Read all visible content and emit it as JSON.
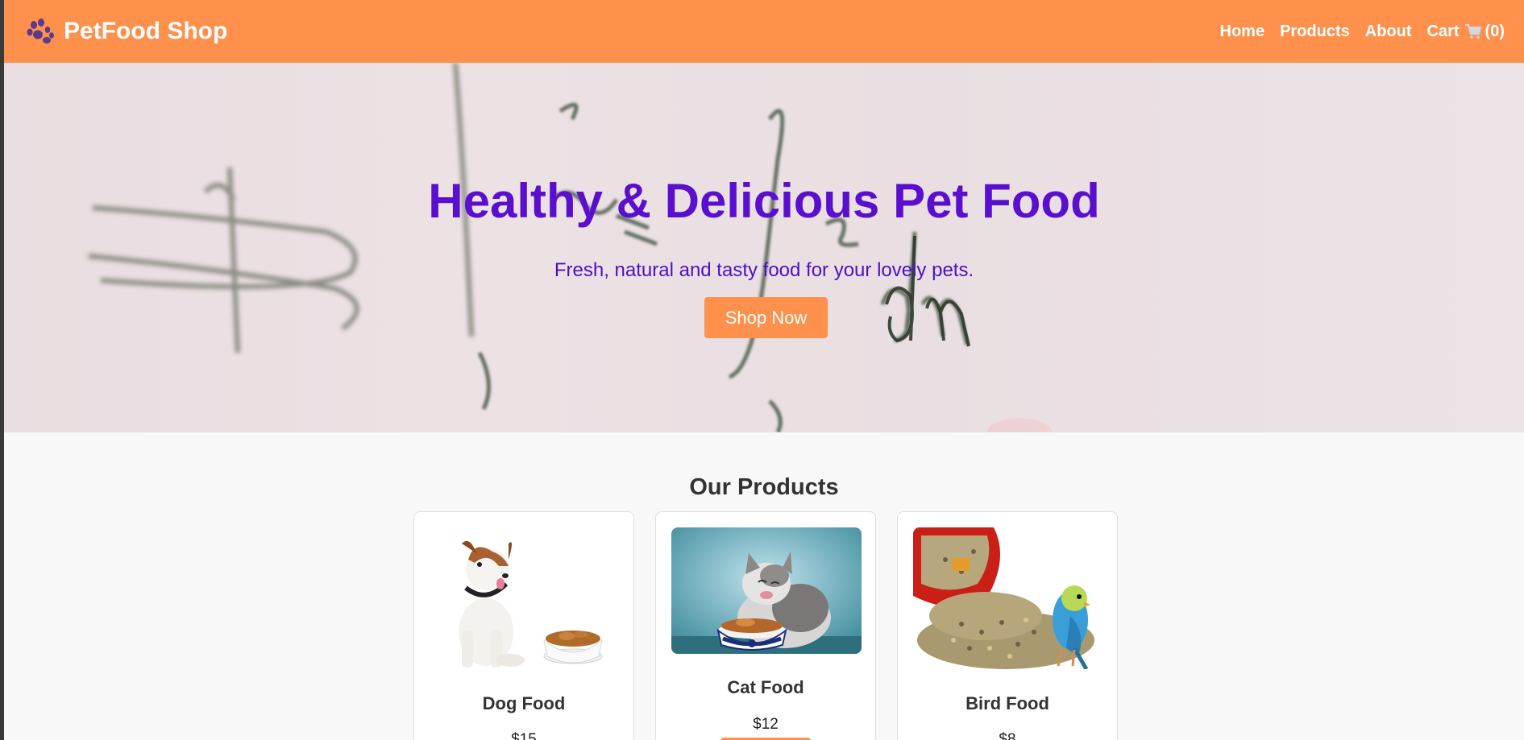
{
  "header": {
    "brand": "PetFood Shop",
    "brand_icon": "paw-icon",
    "nav": [
      {
        "label": "Home"
      },
      {
        "label": "Products"
      },
      {
        "label": "About"
      }
    ],
    "cart": {
      "label": "Cart",
      "icon": "cart-icon",
      "count_text": "(0)"
    }
  },
  "hero": {
    "title": "Healthy & Delicious Pet Food",
    "subtitle": "Fresh, natural and tasty food for your lovely pets.",
    "cta": "Shop Now"
  },
  "products": {
    "heading": "Our Products",
    "items": [
      {
        "name": "Dog Food",
        "price": "$15",
        "image": "dog-with-food-bowl"
      },
      {
        "name": "Cat Food",
        "price": "$12",
        "image": "cat-eating-from-bowl"
      },
      {
        "name": "Bird Food",
        "price": "$8",
        "image": "parakeet-with-seed-bowl"
      }
    ]
  },
  "colors": {
    "accent": "#ff914d",
    "hero_title": "#5a0fd0",
    "hero_subtitle": "#4a10c8",
    "page_background": "#f8f8f8"
  }
}
